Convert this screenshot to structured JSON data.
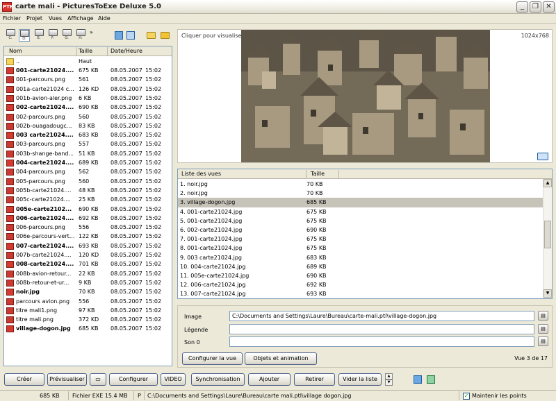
{
  "window": {
    "title": "carte mali - PicturesToExe Deluxe 5.0",
    "app_icon": "PTE"
  },
  "menu": [
    "Fichier",
    "Projet",
    "Vues",
    "Affichage",
    "Aide"
  ],
  "toolbar": {
    "drive_labels": [
      "C:",
      "D:",
      "E:",
      "F:",
      "G:",
      "H:"
    ],
    "more": "»"
  },
  "file_list": {
    "headers": {
      "name": "Nom",
      "size": "Taille",
      "date": "Date/Heure"
    },
    "up_row": {
      "name": "..",
      "size": "Haut"
    },
    "rows": [
      {
        "name": "001-carte21024....",
        "size": "675 KB",
        "date": "08.05.2007",
        "time": "15:02",
        "bold": true,
        "type": "jpg"
      },
      {
        "name": "001-parcours.png",
        "size": "561",
        "date": "08.05.2007",
        "time": "15:02",
        "bold": false,
        "type": "png"
      },
      {
        "name": "001a-carte21024 c...",
        "size": "126 KD",
        "date": "08.05.2007",
        "time": "15:02",
        "bold": false,
        "type": "png"
      },
      {
        "name": "001b-avion-aler.png",
        "size": "6 KB",
        "date": "08.05.2007",
        "time": "15:02",
        "bold": false,
        "type": "png"
      },
      {
        "name": "002-carte21024....",
        "size": "690 KB",
        "date": "08.05.2007",
        "time": "15:02",
        "bold": true,
        "type": "jpg"
      },
      {
        "name": "002-parcours.png",
        "size": "560",
        "date": "08.05.2007",
        "time": "15:02",
        "bold": false,
        "type": "png"
      },
      {
        "name": "002b-ouagadougc...",
        "size": "83 KB",
        "date": "08.05.2007",
        "time": "15:02",
        "bold": false,
        "type": "png"
      },
      {
        "name": "003 carte21024....",
        "size": "683 KB",
        "date": "08.05.2007",
        "time": "15:02",
        "bold": true,
        "type": "jpg"
      },
      {
        "name": "003-parcours.png",
        "size": "557",
        "date": "08.05.2007",
        "time": "15:02",
        "bold": false,
        "type": "png"
      },
      {
        "name": "003b-shange-band...",
        "size": "51 KB",
        "date": "08.05.2007",
        "time": "15:02",
        "bold": false,
        "type": "png"
      },
      {
        "name": "004-carte21024....",
        "size": "689 KB",
        "date": "08.05.2007",
        "time": "15:02",
        "bold": true,
        "type": "jpg"
      },
      {
        "name": "004-parcours.png",
        "size": "562",
        "date": "08.05.2007",
        "time": "15:02",
        "bold": false,
        "type": "png"
      },
      {
        "name": "005-parcours.png",
        "size": "560",
        "date": "08.05.2007",
        "time": "15:02",
        "bold": false,
        "type": "png"
      },
      {
        "name": "005b-carte21024....",
        "size": "48 KB",
        "date": "08.05.2007",
        "time": "15:02",
        "bold": false,
        "type": "png"
      },
      {
        "name": "005c-carte21024....",
        "size": "25 KB",
        "date": "08.05.2007",
        "time": "15:02",
        "bold": false,
        "type": "png"
      },
      {
        "name": "005e-carte2102...",
        "size": "690 KB",
        "date": "08.05.2007",
        "time": "15:02",
        "bold": true,
        "type": "jpg"
      },
      {
        "name": "006-carte21024....",
        "size": "692 KB",
        "date": "08.05.2007",
        "time": "15:02",
        "bold": true,
        "type": "jpg"
      },
      {
        "name": "006-parcours.png",
        "size": "556",
        "date": "08.05.2007",
        "time": "15:02",
        "bold": false,
        "type": "png"
      },
      {
        "name": "006e-parcours-vert...",
        "size": "122 KB",
        "date": "08.05.2007",
        "time": "15:02",
        "bold": false,
        "type": "png"
      },
      {
        "name": "007-carte21024....",
        "size": "693 KB",
        "date": "08.05.2007",
        "time": "15:02",
        "bold": true,
        "type": "jpg"
      },
      {
        "name": "007b-carte21024....",
        "size": "120 KD",
        "date": "08.05.2007",
        "time": "15:02",
        "bold": false,
        "type": "png"
      },
      {
        "name": "008-carte21024....",
        "size": "701 KB",
        "date": "08.05.2007",
        "time": "15:02",
        "bold": true,
        "type": "jpg"
      },
      {
        "name": "008b-avion-retour...",
        "size": "22 KB",
        "date": "08.05.2007",
        "time": "15:02",
        "bold": false,
        "type": "png"
      },
      {
        "name": "008b-retour-et-ur...",
        "size": "9 KB",
        "date": "08.05.2007",
        "time": "15:02",
        "bold": false,
        "type": "png"
      },
      {
        "name": "noir.jpg",
        "size": "70 KB",
        "date": "08.05.2007",
        "time": "15:02",
        "bold": true,
        "type": "jpg"
      },
      {
        "name": "parcours avion.png",
        "size": "556",
        "date": "08.05.2007",
        "time": "15:02",
        "bold": false,
        "type": "png"
      },
      {
        "name": "titre mali1.png",
        "size": "97 KB",
        "date": "08.05.2007",
        "time": "15:02",
        "bold": false,
        "type": "png"
      },
      {
        "name": "titre mali.png",
        "size": "372 KD",
        "date": "08.05.2007",
        "time": "15:02",
        "bold": false,
        "type": "png"
      },
      {
        "name": "village-dogon.jpg",
        "size": "685 KB",
        "date": "08.05.2007",
        "time": "15:02",
        "bold": true,
        "type": "jpg"
      }
    ]
  },
  "preview": {
    "hint": "Cliquer pour visualiser plein écran",
    "resolution": "1024x768"
  },
  "slides": {
    "headers": {
      "name": "Liste des vues",
      "size": "Taille"
    },
    "rows": [
      {
        "name": "1. noir.jpg",
        "size": "70 KB",
        "selected": false
      },
      {
        "name": "2. noir.jpg",
        "size": "70 KB",
        "selected": false
      },
      {
        "name": "3. village-dogon.jpg",
        "size": "685 KB",
        "selected": true
      },
      {
        "name": "4. 001-carte21024.jpg",
        "size": "675 KB",
        "selected": false
      },
      {
        "name": "5. 001-carte21024.jpg",
        "size": "675 KB",
        "selected": false
      },
      {
        "name": "6. 002-carte21024.jpg",
        "size": "690 KB",
        "selected": false
      },
      {
        "name": "7. 001-carte21024.jpg",
        "size": "675 KB",
        "selected": false
      },
      {
        "name": "8. 001-carte21024.jpg",
        "size": "675 KB",
        "selected": false
      },
      {
        "name": "9. 003 carte21024.jpg",
        "size": "683 KB",
        "selected": false
      },
      {
        "name": "10. 004-carte21024.jpg",
        "size": "689 KB",
        "selected": false
      },
      {
        "name": "11. 005e-carte21024.jpg",
        "size": "690 KB",
        "selected": false
      },
      {
        "name": "12. 006-carte21024.jpg",
        "size": "692 KB",
        "selected": false
      },
      {
        "name": "13. 007-carte21024.jpg",
        "size": "693 KB",
        "selected": false
      }
    ]
  },
  "properties": {
    "image_label": "Image",
    "image_value": "C:\\Documents and Settings\\Laure\\Bureau\\carte-mali.ptl\\village-dogon.jpg",
    "caption_label": "Légende",
    "caption_value": "",
    "sound_label": "Son 0",
    "sound_value": "",
    "configure_slide": "Configurer la vue",
    "objects_animation": "Objets et animation",
    "slide_counter": "Vue 3 de 17"
  },
  "bottom_buttons": {
    "create": "Créer",
    "preview": "Prévisualiser",
    "configure": "Configurer",
    "video": "VIDEO",
    "sync": "Synchronisation",
    "add": "Ajouter",
    "remove": "Retirer",
    "clear": "Vider la liste"
  },
  "status": {
    "size": "685 KB",
    "exe": "Fichier EXE  15.4 MB",
    "p": "P",
    "path": "C:\\Documents and Settings\\Laure\\Bureau\\carte mali.ptl\\village dogon.jpg",
    "keep_points": "Maintenir les points"
  }
}
